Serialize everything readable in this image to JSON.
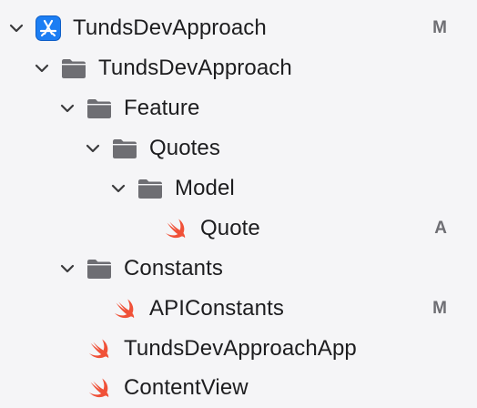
{
  "navigator": {
    "items": [
      {
        "label": "TundsDevApproach",
        "badge": "M",
        "icon": "xcode-project-icon",
        "expanded": true
      },
      {
        "label": "TundsDevApproach",
        "icon": "folder-icon",
        "expanded": true
      },
      {
        "label": "Feature",
        "icon": "folder-icon",
        "expanded": true
      },
      {
        "label": "Quotes",
        "icon": "folder-icon",
        "expanded": true
      },
      {
        "label": "Model",
        "icon": "folder-icon",
        "expanded": true
      },
      {
        "label": "Quote",
        "badge": "A",
        "icon": "swift-file-icon"
      },
      {
        "label": "Constants",
        "icon": "folder-icon",
        "expanded": true
      },
      {
        "label": "APIConstants",
        "badge": "M",
        "icon": "swift-file-icon"
      },
      {
        "label": "TundsDevApproachApp",
        "icon": "swift-file-icon"
      },
      {
        "label": "ContentView",
        "icon": "swift-file-icon"
      }
    ]
  },
  "colors": {
    "background": "#f5f5f7",
    "folder": "#6e6e73",
    "swift": "#f05138",
    "xcode_blue": "#1c7ef3",
    "badge": "#6e6e73",
    "chevron": "#3a3a3c"
  }
}
